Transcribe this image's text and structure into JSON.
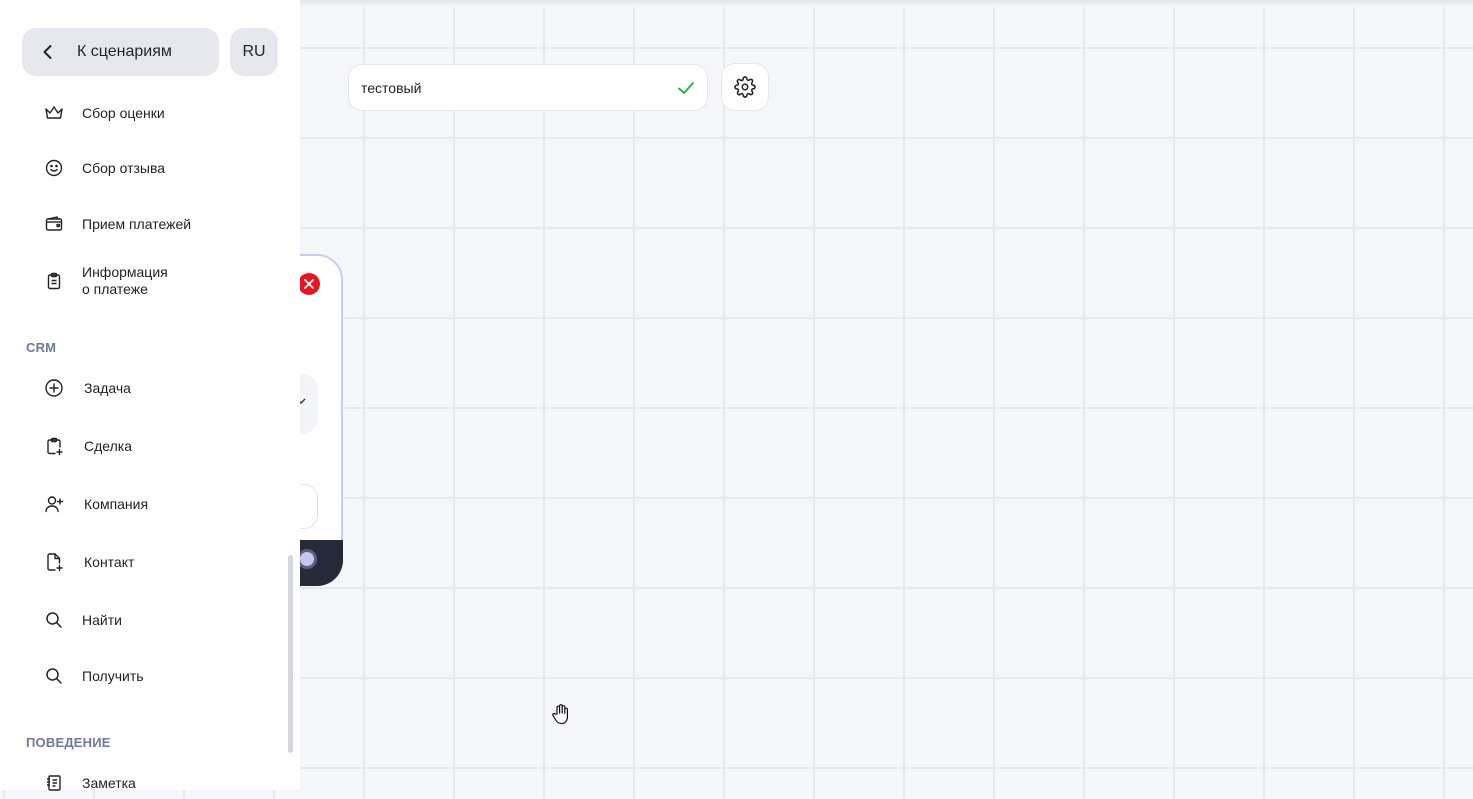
{
  "sidebar": {
    "back_label": "К сценариям",
    "lang": "RU",
    "items_top": [
      {
        "label": "Сбор оценки",
        "icon": "crown-icon"
      },
      {
        "label": "Сбор отзыва",
        "icon": "smile-icon"
      },
      {
        "label": "Прием платежей",
        "icon": "wallet-icon"
      },
      {
        "label": "Информация\nо платеже",
        "icon": "clipboard-icon"
      }
    ],
    "section_crm": "CRM",
    "crm_items": [
      {
        "label": "Задача",
        "icon": "plus-circle-icon"
      },
      {
        "label": "Сделка",
        "icon": "clipboard-plus-icon"
      },
      {
        "label": "Компания",
        "icon": "user-plus-icon"
      },
      {
        "label": "Контакт",
        "icon": "file-plus-icon"
      },
      {
        "label": "Найти",
        "icon": "search-icon"
      },
      {
        "label": "Получить",
        "icon": "search-icon"
      }
    ],
    "section_behavior": "ПОВЕДЕНИЕ",
    "behavior_items": [
      {
        "label": "Заметка",
        "icon": "note-icon"
      }
    ]
  },
  "canvas": {
    "scenario_name": "тестовый"
  },
  "colors": {
    "accent_green": "#2bb24c",
    "close_red": "#e8141f",
    "section_text": "#6b7a99",
    "node_border": "#c9cbf0"
  }
}
